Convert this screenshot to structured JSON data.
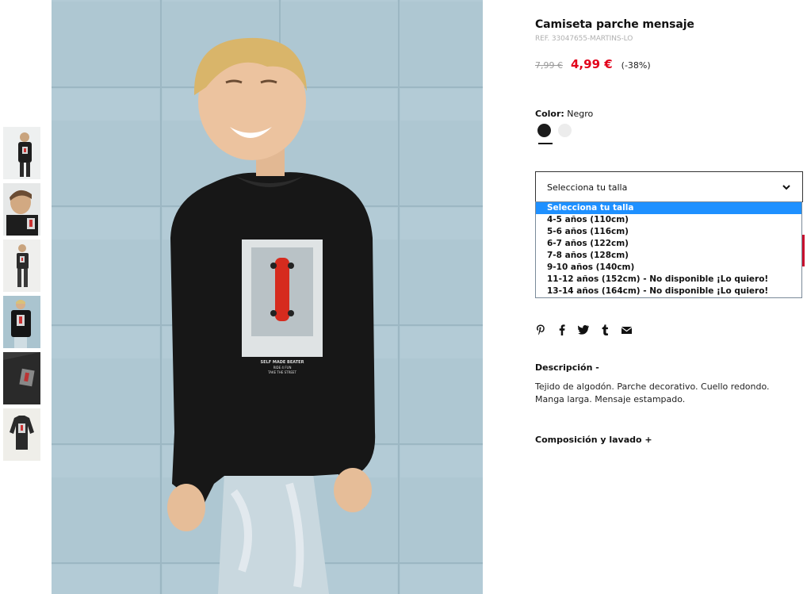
{
  "product": {
    "title": "Camiseta parche mensaje",
    "ref": "REF. 33047655-MARTINS-LO",
    "price_old": "7,99 €",
    "price_new": "4,99 €",
    "discount": "(-38%)"
  },
  "color": {
    "label": "Color:",
    "value": "Negro",
    "swatches": [
      {
        "name": "Negro",
        "hex": "#1b1b1b",
        "selected": true
      },
      {
        "name": "Blanco",
        "hex": "#ececec",
        "selected": false
      }
    ]
  },
  "size": {
    "placeholder": "Selecciona tu talla",
    "options": [
      "Selecciona tu talla",
      "4-5 años (110cm)",
      "5-6 años (116cm)",
      "6-7 años (122cm)",
      "7-8 años (128cm)",
      "9-10 años (140cm)",
      "11-12 años (152cm) - No disponible ¡Lo quiero!",
      "13-14 años (164cm) - No disponible ¡Lo quiero!"
    ],
    "highlighted_index": 0
  },
  "share_icons": [
    "pinterest-icon",
    "facebook-icon",
    "twitter-icon",
    "tumblr-icon",
    "email-icon"
  ],
  "description": {
    "title": "Descripción -",
    "text": "Tejido de algodón. Parche decorativo. Cuello redondo. Manga larga. Mensaje estampado."
  },
  "composition": {
    "title": "Composición y lavado +"
  },
  "image": {
    "patch_text_1": "SELF MADE BEATER",
    "patch_text_2": "RIDE 4 FUN",
    "patch_text_3": "TAKE THE STREET"
  },
  "colors": {
    "sale_red": "#e2001a",
    "wall_blue": "#aac4cf",
    "select_highlight": "#1e90ff"
  }
}
